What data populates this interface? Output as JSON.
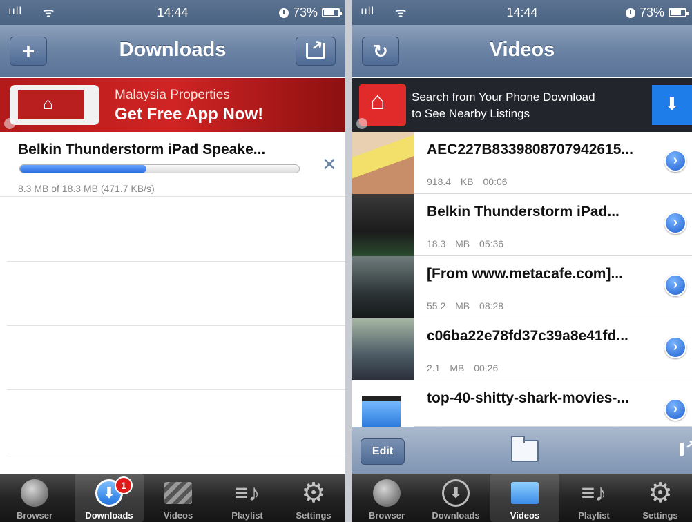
{
  "status": {
    "time": "14:44",
    "battery": "73%",
    "signal": "ııll",
    "wifi": "ᯤ"
  },
  "left": {
    "nav_title": "Downloads",
    "nav_left_glyph": "+",
    "ad": {
      "line1": "Malaysia Properties",
      "line2": "Get Free App Now!"
    },
    "download": {
      "title": "Belkin Thunderstorm iPad Speake...",
      "status": "8.3 MB of 18.3 MB (471.7 KB/s)",
      "progress_fraction": 0.454,
      "cancel_glyph": "✕"
    },
    "badge": "1"
  },
  "right": {
    "nav_title": "Videos",
    "nav_left_glyph": "↻",
    "ad": {
      "line1": "Search from Your Phone Download",
      "line2": "to See Nearby Listings"
    },
    "videos": [
      {
        "title": "AEC227B8339808707942615...",
        "size": "918.4 KB",
        "duration": "00:06"
      },
      {
        "title": "Belkin Thunderstorm iPad...",
        "size": "18.3 MB",
        "duration": "05:36"
      },
      {
        "title": "[From www.metacafe.com]...",
        "size": "55.2 MB",
        "duration": "08:28"
      },
      {
        "title": "c06ba22e78fd37c39a8e41fd...",
        "size": "2.1 MB",
        "duration": "00:26"
      },
      {
        "title": "top-40-shitty-shark-movies-...",
        "size": "",
        "duration": ""
      }
    ],
    "toolbar": {
      "edit_label": "Edit"
    },
    "disclosure_glyph": "›"
  },
  "tabs": [
    {
      "label": "Browser",
      "icon": "globe-icon"
    },
    {
      "label": "Downloads",
      "icon": "download-icon"
    },
    {
      "label": "Videos",
      "icon": "clapperboard-icon"
    },
    {
      "label": "Playlist",
      "icon": "playlist-icon"
    },
    {
      "label": "Settings",
      "icon": "gear-icon"
    }
  ],
  "icon_glyphs": {
    "download": "⬇",
    "playlist": "≡♪",
    "gear": "⚙"
  },
  "colors": {
    "accent": "#2a6fe0",
    "badge": "#e01919",
    "nav": "#6a82a3"
  }
}
